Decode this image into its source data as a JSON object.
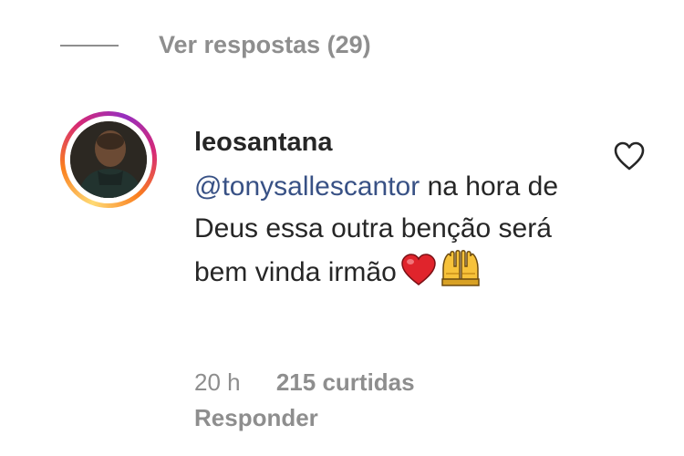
{
  "replies": {
    "view_label": "Ver respostas (29)"
  },
  "comment": {
    "username": "leosantana",
    "mention": "@tonysallescantor",
    "text": " na hora de Deus essa outra benção será bem vinda irmão",
    "time": "20 h",
    "likes": "215 curtidas",
    "reply_label": "Responder"
  },
  "icons": {
    "like": "heart-outline-icon",
    "emoji_1": "red-heart-emoji",
    "emoji_2": "raising-hands-emoji"
  },
  "colors": {
    "text": "#262626",
    "secondary": "#8e8e8e",
    "mention": "#385185"
  }
}
